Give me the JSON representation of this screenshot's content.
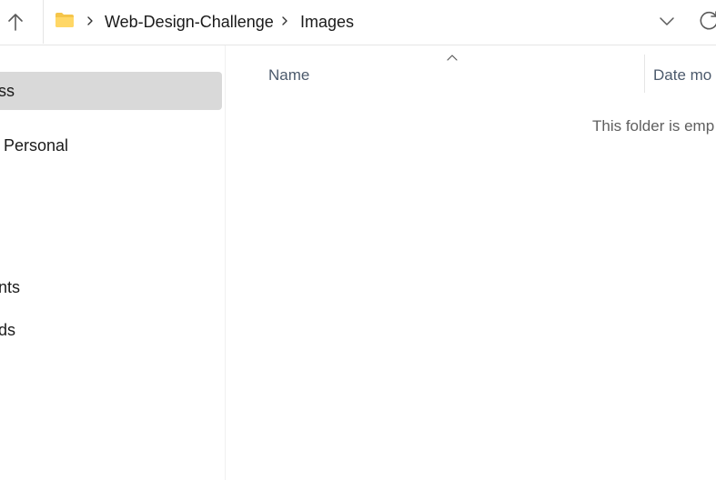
{
  "address_bar": {
    "breadcrumbs": [
      "Web-Design-Challenge",
      "Images"
    ],
    "folder_icon": "folder-icon",
    "separator_icon": "chevron-right-icon",
    "folder_color": "#F5C54A"
  },
  "toolbar": {
    "up_icon": "arrow-up-icon",
    "dropdown_icon": "chevron-down-icon",
    "refresh_icon": "refresh-icon"
  },
  "sidebar": {
    "items": [
      {
        "label": "ss",
        "selected": true
      },
      {
        "label": "Personal",
        "selected": false
      },
      {
        "label": "nts",
        "selected": false
      },
      {
        "label": "ds",
        "selected": false
      }
    ],
    "selected_color": "#D9D9D9"
  },
  "file_list": {
    "columns": [
      "Name",
      "Date mo"
    ],
    "sort_icon": "sort-ascending-icon",
    "empty_message": "This folder is emp"
  }
}
